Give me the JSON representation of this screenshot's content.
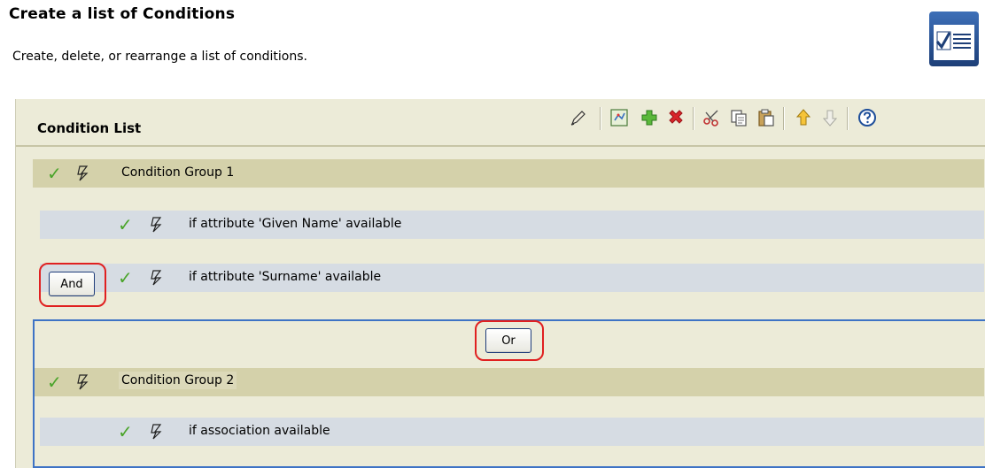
{
  "header": {
    "title": "Create a list of Conditions",
    "description": "Create, delete, or rearrange a list of conditions."
  },
  "panel": {
    "title": "Condition List",
    "toolbar": [
      "edit-icon",
      "add-from-wizard-icon",
      "add-icon",
      "delete-icon",
      "cut-icon",
      "copy-icon",
      "paste-icon",
      "move-up-icon",
      "move-down-icon",
      "help-icon"
    ]
  },
  "rows": {
    "group1": "Condition Group 1",
    "cond1": "if attribute 'Given Name' available",
    "cond2": "if attribute 'Surname' available",
    "group2": "Condition Group 2",
    "cond3": "if association available"
  },
  "buttons": {
    "and": "And",
    "or": "Or"
  },
  "colors": {
    "panel_bg": "#ecebd8",
    "group_row": "#d4d1aa",
    "condition_row": "#d6dce3",
    "check_green": "#4aa42a",
    "highlight_red": "#e02020",
    "selection_blue": "#3e73c5"
  }
}
